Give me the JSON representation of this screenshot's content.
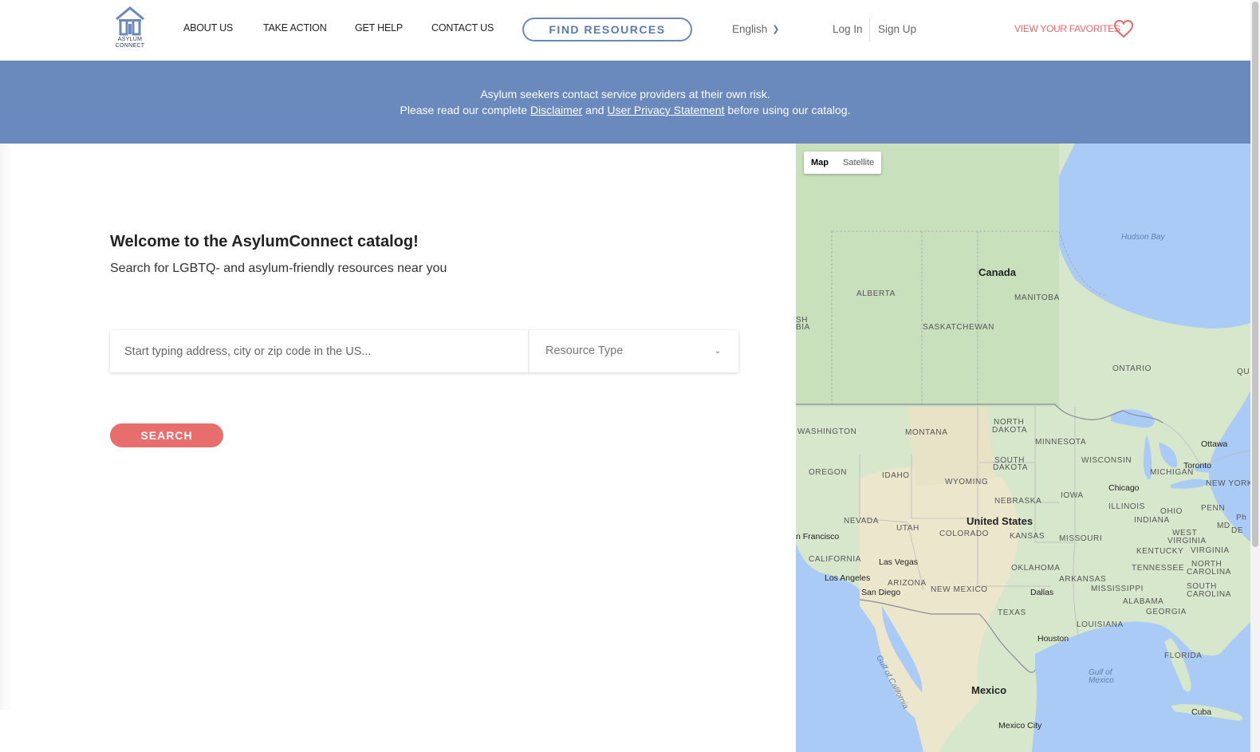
{
  "header": {
    "logo_text": "ASYLUM CONNECT",
    "nav": [
      "ABOUT US",
      "TAKE ACTION",
      "GET HELP",
      "CONTACT US"
    ],
    "find_resources": "FIND RESOURCES",
    "language": "English",
    "login": "Log In",
    "signup": "Sign Up",
    "favorites": "VIEW YOUR FAVORITES"
  },
  "banner": {
    "line1": "Asylum seekers contact service providers at their own risk.",
    "line2_pre": "Please read our complete ",
    "disclaimer": "Disclaimer",
    "and": " and ",
    "privacy": "User Privacy Statement",
    "line2_post": " before using our catalog."
  },
  "main": {
    "title": "Welcome to the AsylumConnect catalog!",
    "subtitle": "Search for LGBTQ- and asylum-friendly resources near you",
    "search_placeholder": "Start typing address, city or zip code in the US...",
    "resource_type": "Resource Type",
    "search_button": "SEARCH"
  },
  "map": {
    "toggle_map": "Map",
    "toggle_satellite": "Satellite",
    "labels": {
      "hudson_bay": "Hudson Bay",
      "canada": "Canada",
      "alberta": "ALBERTA",
      "manitoba": "MANITOBA",
      "saskatchewan": "SASKATCHEWAN",
      "ontario": "ONTARIO",
      "bc1": "SH",
      "bc2": "BIA",
      "qu": "QU",
      "washington": "WASHINGTON",
      "montana": "MONTANA",
      "north": "NORTH",
      "dakota": "DAKOTA",
      "minnesota": "MINNESOTA",
      "ottawa": "Ottawa",
      "wisconsin": "WISCONSIN",
      "south": "SOUTH",
      "dakota2": "DAKOTA",
      "toronto": "Toronto",
      "oregon": "OREGON",
      "michigan": "MICHIGAN",
      "idaho": "IDAHO",
      "wyoming": "WYOMING",
      "new_york": "NEW YORK",
      "chicago": "Chicago",
      "iowa": "IOWA",
      "nebraska": "NEBRASKA",
      "illinois": "ILLINOIS",
      "penn": "PENN",
      "ohio": "OHIO",
      "united_states": "United States",
      "nevada": "NEVADA",
      "utah": "UTAH",
      "colorado": "COLORADO",
      "indiana": "INDIANA",
      "west": "WEST",
      "virginia1": "VIRGINIA",
      "md": "MD",
      "de": "DE",
      "ph": "Ph",
      "san_francisco": "n Francisco",
      "kansas": "KANSAS",
      "missouri": "MISSOURI",
      "kentucky": "KENTUCKY",
      "virginia2": "VIRGINIA",
      "california": "CALIFORNIA",
      "las_vegas": "Las Vegas",
      "tennessee": "TENNESSEE",
      "north2": "NORTH",
      "carolina1": "CAROLINA",
      "oklahoma": "OKLAHOMA",
      "los_angeles": "Los Angeles",
      "arizona": "ARIZONA",
      "arkansas": "ARKANSAS",
      "san_diego": "San Diego",
      "new_mexico": "NEW MEXICO",
      "dallas": "Dallas",
      "mississippi": "MISSISSIPPI",
      "alabama": "ALABAMA",
      "south2": "SOUTH",
      "carolina2": "CAROLINA",
      "georgia": "GEORGIA",
      "texas": "TEXAS",
      "louisiana": "LOUISIANA",
      "houston": "Houston",
      "gulf_ca": "Gulf of California",
      "florida": "FLORIDA",
      "gulf_mx1": "Gulf of",
      "gulf_mx2": "Mexico",
      "mexico": "Mexico",
      "cuba": "Cuba",
      "mexico_city": "Mexico City"
    }
  },
  "colors": {
    "brand_blue": "#6a89bd",
    "accent_red": "#e86e6e",
    "favorites_red": "#e46a6a"
  }
}
